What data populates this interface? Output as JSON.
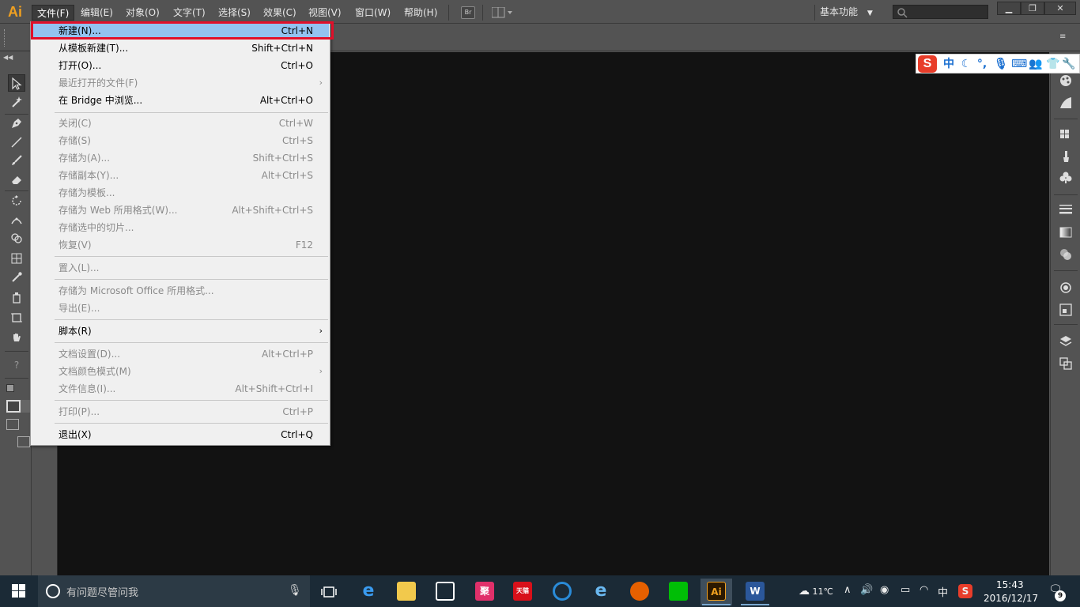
{
  "app": {
    "logo": "Ai"
  },
  "menubar": {
    "items": [
      "文件(F)",
      "编辑(E)",
      "对象(O)",
      "文字(T)",
      "选择(S)",
      "效果(C)",
      "视图(V)",
      "窗口(W)",
      "帮助(H)"
    ],
    "bridge_label": "Br",
    "workspace": "基本功能"
  },
  "file_menu": {
    "items": [
      {
        "label": "新建(N)...",
        "shortcut": "Ctrl+N",
        "enabled": true,
        "highlight": true
      },
      {
        "label": "从模板新建(T)...",
        "shortcut": "Shift+Ctrl+N",
        "enabled": true
      },
      {
        "label": "打开(O)...",
        "shortcut": "Ctrl+O",
        "enabled": true
      },
      {
        "label": "最近打开的文件(F)",
        "shortcut": "",
        "enabled": false,
        "submenu": true
      },
      {
        "label": "在 Bridge 中浏览...",
        "shortcut": "Alt+Ctrl+O",
        "enabled": true
      },
      {
        "label": "关闭(C)",
        "shortcut": "Ctrl+W",
        "enabled": false
      },
      {
        "label": "存储(S)",
        "shortcut": "Ctrl+S",
        "enabled": false
      },
      {
        "label": "存储为(A)...",
        "shortcut": "Shift+Ctrl+S",
        "enabled": false
      },
      {
        "label": "存储副本(Y)...",
        "shortcut": "Alt+Ctrl+S",
        "enabled": false
      },
      {
        "label": "存储为模板...",
        "shortcut": "",
        "enabled": false
      },
      {
        "label": "存储为 Web 所用格式(W)...",
        "shortcut": "Alt+Shift+Ctrl+S",
        "enabled": false
      },
      {
        "label": "存储选中的切片...",
        "shortcut": "",
        "enabled": false
      },
      {
        "label": "恢复(V)",
        "shortcut": "F12",
        "enabled": false
      },
      {
        "label": "置入(L)...",
        "shortcut": "",
        "enabled": false
      },
      {
        "label": "存储为 Microsoft Office 所用格式...",
        "shortcut": "",
        "enabled": false
      },
      {
        "label": "导出(E)...",
        "shortcut": "",
        "enabled": false
      },
      {
        "label": "脚本(R)",
        "shortcut": "",
        "enabled": true,
        "submenu": true
      },
      {
        "label": "文档设置(D)...",
        "shortcut": "Alt+Ctrl+P",
        "enabled": false
      },
      {
        "label": "文档颜色模式(M)",
        "shortcut": "",
        "enabled": false,
        "submenu": true
      },
      {
        "label": "文件信息(I)...",
        "shortcut": "Alt+Shift+Ctrl+I",
        "enabled": false
      },
      {
        "label": "打印(P)...",
        "shortcut": "Ctrl+P",
        "enabled": false
      },
      {
        "label": "退出(X)",
        "shortcut": "Ctrl+Q",
        "enabled": true
      }
    ]
  },
  "ime": {
    "logo": "S",
    "mode": "中"
  },
  "toolbar": {
    "help_label": "?"
  },
  "taskbar": {
    "search_placeholder": "有问题尽管问我",
    "apps": [
      "聚",
      "天猫",
      "Ai",
      "W"
    ],
    "weather": "11℃",
    "ime_mode": "中",
    "time": "15:43",
    "date": "2016/12/17",
    "notifications": "9"
  },
  "colors": {
    "highlight_border": "#e0102a",
    "menu_highlight": "#93c3f0",
    "ai_orange": "#f0a020"
  }
}
